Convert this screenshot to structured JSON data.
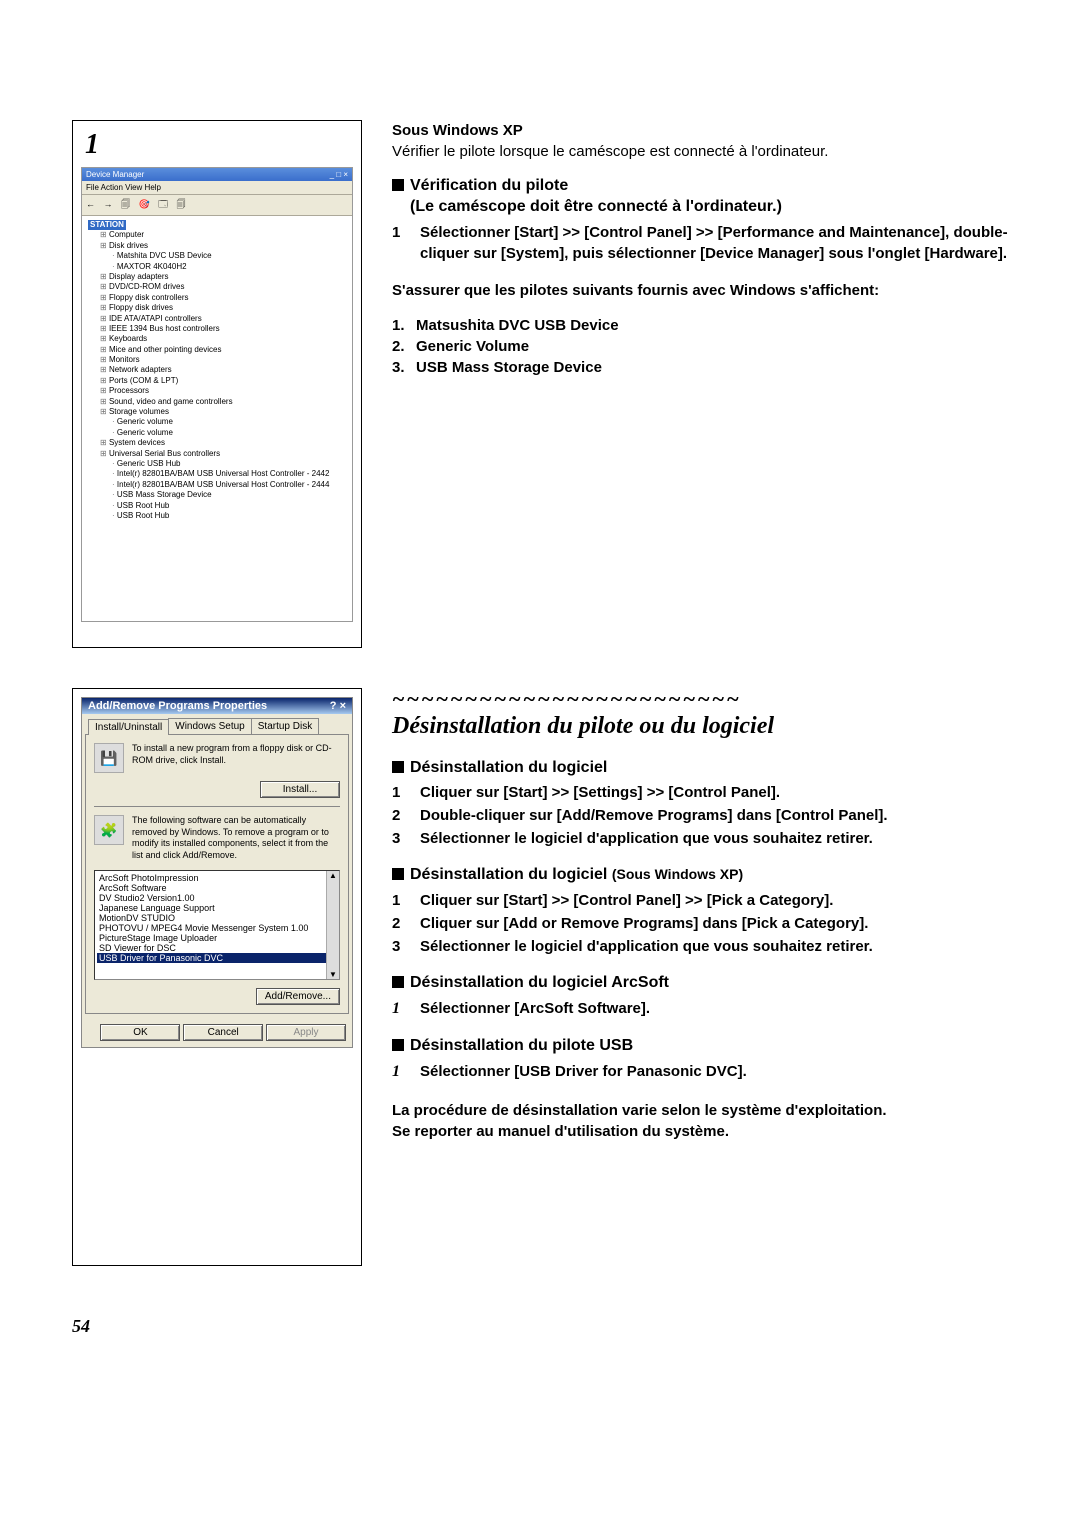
{
  "section1": {
    "boxnum": "1",
    "devmgr": {
      "title": "Device Manager",
      "menu": "File  Action  View  Help",
      "root": "STATION",
      "tree": [
        {
          "label": "Computer",
          "children": []
        },
        {
          "label": "Disk drives",
          "children": [
            {
              "label": "Matshita DVC USB Device",
              "leaf": true
            },
            {
              "label": "MAXTOR 4K040H2",
              "leaf": true
            }
          ]
        },
        {
          "label": "Display adapters",
          "children": []
        },
        {
          "label": "DVD/CD-ROM drives",
          "children": []
        },
        {
          "label": "Floppy disk controllers",
          "children": []
        },
        {
          "label": "Floppy disk drives",
          "children": []
        },
        {
          "label": "IDE ATA/ATAPI controllers",
          "children": []
        },
        {
          "label": "IEEE 1394 Bus host controllers",
          "children": []
        },
        {
          "label": "Keyboards",
          "children": []
        },
        {
          "label": "Mice and other pointing devices",
          "children": []
        },
        {
          "label": "Monitors",
          "children": []
        },
        {
          "label": "Network adapters",
          "children": []
        },
        {
          "label": "Ports (COM & LPT)",
          "children": []
        },
        {
          "label": "Processors",
          "children": []
        },
        {
          "label": "Sound, video and game controllers",
          "children": []
        },
        {
          "label": "Storage volumes",
          "children": [
            {
              "label": "Generic volume",
              "leaf": true
            },
            {
              "label": "Generic volume",
              "leaf": true
            }
          ]
        },
        {
          "label": "System devices",
          "children": []
        },
        {
          "label": "Universal Serial Bus controllers",
          "children": [
            {
              "label": "Generic USB Hub",
              "leaf": true
            },
            {
              "label": "Intel(r) 82801BA/BAM USB Universal Host Controller - 2442",
              "leaf": true
            },
            {
              "label": "Intel(r) 82801BA/BAM USB Universal Host Controller - 2444",
              "leaf": true
            },
            {
              "label": "USB Mass Storage Device",
              "leaf": true
            },
            {
              "label": "USB Root Hub",
              "leaf": true
            },
            {
              "label": "USB Root Hub",
              "leaf": true
            }
          ]
        }
      ]
    },
    "os_heading": "Sous Windows XP",
    "os_note": "Vérifier le pilote lorsque le caméscope est connecté à l'ordinateur.",
    "h1_line1": "Vérification du pilote",
    "h1_line2": "(Le caméscope doit être connecté à l'ordinateur.)",
    "step1_num": "1",
    "step1_text": "Sélectionner [Start] >> [Control Panel] >> [Performance and Maintenance], double-cliquer sur [System], puis sélectionner [Device Manager] sous l'onglet [Hardware].",
    "drivers_intro": "S'assurer que les pilotes suivants fournis avec Windows s'affichent:",
    "drivers": [
      {
        "n": "1.",
        "t": "Matsushita DVC USB Device"
      },
      {
        "n": "2.",
        "t": "Generic Volume"
      },
      {
        "n": "3.",
        "t": "USB Mass Storage Device"
      }
    ]
  },
  "section2": {
    "wave": "~~~~~~~~~~~~~~~~~~~~~~~~",
    "title": "Désinstallation du pilote ou du logiciel",
    "addremove": {
      "title": "Add/Remove Programs Properties",
      "tabs": [
        "Install/Uninstall",
        "Windows Setup",
        "Startup Disk"
      ],
      "row1": "To install a new program from a floppy disk or CD-ROM drive, click Install.",
      "btn_install": "Install...",
      "row2": "The following software can be automatically removed by Windows. To remove a program or to modify its installed components, select it from the list and click Add/Remove.",
      "listitems": [
        "ArcSoft PhotoImpression",
        "ArcSoft Software",
        "DV Studio2 Version1.00",
        "Japanese Language Support",
        "MotionDV STUDIO",
        "PHOTOVU / MPEG4 Movie Messenger System 1.00",
        "PictureStage Image Uploader",
        "SD Viewer for DSC",
        "USB Driver for Panasonic DVC"
      ],
      "selected": "USB Driver for Panasonic DVC",
      "btn_addremove": "Add/Remove...",
      "btn_ok": "OK",
      "btn_cancel": "Cancel",
      "btn_apply": "Apply"
    },
    "h_a": "Désinstallation du logiciel",
    "a_steps": [
      {
        "n": "1",
        "t": "Cliquer sur [Start] >> [Settings] >> [Control Panel]."
      },
      {
        "n": "2",
        "t": "Double-cliquer sur [Add/Remove Programs] dans [Control Panel]."
      },
      {
        "n": "3",
        "t": "Sélectionner le logiciel d'application que vous souhaitez retirer."
      }
    ],
    "h_b_main": "Désinstallation du logiciel ",
    "h_b_sub": "(Sous Windows XP)",
    "b_steps": [
      {
        "n": "1",
        "t": "Cliquer sur [Start] >> [Control Panel] >> [Pick a Category]."
      },
      {
        "n": "2",
        "t": "Cliquer sur [Add or Remove Programs] dans [Pick a Category]."
      },
      {
        "n": "3",
        "t": "Sélectionner le logiciel d'application que vous souhaitez retirer."
      }
    ],
    "h_c": "Désinstallation du logiciel ArcSoft",
    "c_step_num": "1",
    "c_step": "Sélectionner [ArcSoft Software].",
    "h_d": "Désinstallation du pilote USB",
    "d_step_num": "1",
    "d_step": "Sélectionner [USB Driver for Panasonic DVC].",
    "foot1": "La procédure de désinstallation varie selon le système d'exploitation.",
    "foot2": "Se reporter au manuel d'utilisation du système."
  },
  "page_number": "54"
}
